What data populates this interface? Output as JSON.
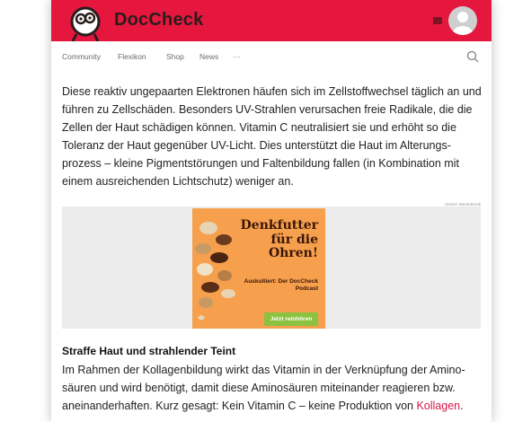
{
  "header": {
    "brand": "DocCheck",
    "colors": {
      "brand_red": "#e5173f",
      "link_pink": "#d8174a"
    }
  },
  "nav": {
    "items": [
      "Community",
      "Flexikon",
      "Shop",
      "News",
      "···"
    ]
  },
  "article": {
    "paragraph_1": "Diese reaktiv ungepaarten Elektronen häufen sich im Zellstoffwechsel täglich an und führen zu Zellschäden. Besonders UV-Strahlen verursachen freie Radikale, die die Zellen der Haut schädigen können. Vitamin C neutralisiert sie und erhöht so die Toleranz der Haut gegenüber UV-Licht. Dies unterstützt die Haut im Alterungs-prozess – kleine Pigmentstörungen und Faltenbildung fallen (in Kombination mit einem ausreichenden Lichtschutz) weniger an.",
    "section_title": "Straffe Haut und strahlender Teint",
    "paragraph_2": "Im Rahmen der Kollagenbildung wirkt das Vitamin in der Verknüpfung der Amino-säuren und wird benötigt, damit diese Aminosäuren miteinander reagieren bzw. aneinanderhaften. Kurz gesagt: Kein Vitamin C – keine Produktion von ",
    "link_text": "Kollagen",
    "paragraph_2_end": "."
  },
  "ad": {
    "label": "Kleiner Werbebreak",
    "title": "Denkfutter für die Ohren!",
    "subtitle": "Auskultiert: Der DocCheck Podcast",
    "cta": "Jetzt reinhören"
  }
}
